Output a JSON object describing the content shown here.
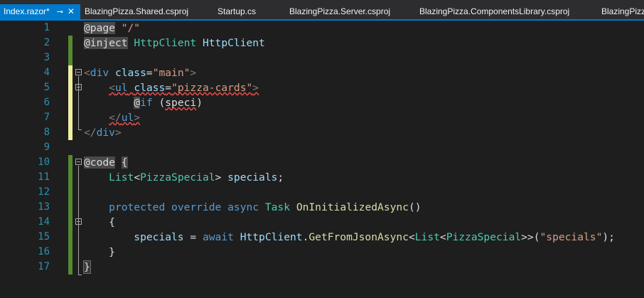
{
  "tabs": [
    {
      "label": "Index.razor*",
      "active": true
    },
    {
      "label": "BlazingPizza.Shared.csproj"
    },
    {
      "label": "Startup.cs"
    },
    {
      "label": "BlazingPizza.Server.csproj"
    },
    {
      "label": "BlazingPizza.ComponentsLibrary.csproj"
    },
    {
      "label": "BlazingPizza"
    }
  ],
  "editor": {
    "line_numbers": [
      "1",
      "2",
      "3",
      "4",
      "5",
      "6",
      "7",
      "8",
      "9",
      "10",
      "11",
      "12",
      "13",
      "14",
      "15",
      "16",
      "17"
    ],
    "lines": {
      "l1": {
        "t1": "@page",
        "t2": " ",
        "t3": "\"/\""
      },
      "l2": {
        "t1": "@inject",
        "t2": " ",
        "t3": "HttpClient",
        "t4": " ",
        "t5": "HttpClient"
      },
      "l4": {
        "t1": "<",
        "t2": "div",
        "t3": " ",
        "t4": "class",
        "t5": "=",
        "t6": "\"main\"",
        "t7": ">"
      },
      "l5": {
        "t0": "    ",
        "t1": "<",
        "t2": "ul",
        "t3": " ",
        "t4": "class",
        "t5": "=",
        "t6": "\"pizza-cards\"",
        "t7": ">"
      },
      "l6": {
        "t0": "        ",
        "t1": "@",
        "t2": "if",
        "t3": " (",
        "t4": "speci",
        "t5": ")"
      },
      "l7": {
        "t0": "    ",
        "t1": "</",
        "t2": "ul",
        "t3": ">"
      },
      "l8": {
        "t1": "</",
        "t2": "div",
        "t3": ">"
      },
      "l10": {
        "t1": "@code",
        "t2": " ",
        "t3": "{"
      },
      "l11": {
        "t0": "    ",
        "t1": "List",
        "t2": "<",
        "t3": "PizzaSpecial",
        "t4": "> ",
        "t5": "specials",
        "t6": ";"
      },
      "l13": {
        "t0": "    ",
        "t1": "protected",
        "t2": " ",
        "t3": "override",
        "t4": " ",
        "t5": "async",
        "t6": " ",
        "t7": "Task",
        "t8": " ",
        "t9": "OnInitializedAsync",
        "t10": "()"
      },
      "l14": {
        "t0": "    ",
        "t1": "{"
      },
      "l15": {
        "t0": "        ",
        "t1": "specials",
        "t2": " = ",
        "t3": "await",
        "t4": " ",
        "t5": "HttpClient",
        "t6": ".",
        "t7": "GetFromJsonAsync",
        "t8": "<",
        "t9": "List",
        "t10": "<",
        "t11": "PizzaSpecial",
        "t12": ">>(",
        "t13": "\"specials\"",
        "t14": ");"
      },
      "l16": {
        "t0": "    ",
        "t1": "}"
      },
      "l17": {
        "t1": "}"
      }
    }
  },
  "colors": {
    "accent": "#007acc",
    "background": "#1e1e1e",
    "line_number": "#2b91af",
    "saved_change": "#578a2f",
    "unsaved_change": "#efefa2",
    "error_squiggle": "#f14c4c"
  }
}
